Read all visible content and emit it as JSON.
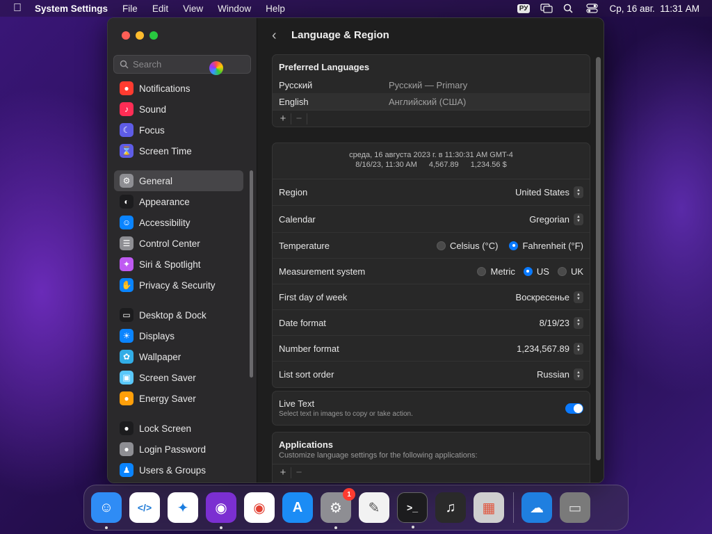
{
  "menubar": {
    "app_name": "System Settings",
    "menus": [
      "File",
      "Edit",
      "View",
      "Window",
      "Help"
    ],
    "input_source": "РУ",
    "clock": "Ср, 16 авг.  11:31 AM"
  },
  "sidebar": {
    "search_placeholder": "Search",
    "groups": [
      [
        {
          "label": "Notifications",
          "icon": "bell-icon",
          "color": "#ff3b30"
        },
        {
          "label": "Sound",
          "icon": "speaker-icon",
          "color": "#ff2d55"
        },
        {
          "label": "Focus",
          "icon": "moon-icon",
          "color": "#5e5ce6"
        },
        {
          "label": "Screen Time",
          "icon": "hourglass-icon",
          "color": "#5e5ce6"
        }
      ],
      [
        {
          "label": "General",
          "icon": "gear-icon",
          "color": "#8e8e93",
          "active": true
        },
        {
          "label": "Appearance",
          "icon": "appearance-icon",
          "color": "#1c1c1e"
        },
        {
          "label": "Accessibility",
          "icon": "accessibility-icon",
          "color": "#0a84ff"
        },
        {
          "label": "Control Center",
          "icon": "toggles-icon",
          "color": "#8e8e93"
        },
        {
          "label": "Siri & Spotlight",
          "icon": "siri-icon",
          "color": "#bf5af2"
        },
        {
          "label": "Privacy & Security",
          "icon": "hand-icon",
          "color": "#0a84ff"
        }
      ],
      [
        {
          "label": "Desktop & Dock",
          "icon": "dock-icon",
          "color": "#1c1c1e"
        },
        {
          "label": "Displays",
          "icon": "sun-icon",
          "color": "#0a84ff"
        },
        {
          "label": "Wallpaper",
          "icon": "flower-icon",
          "color": "#32ade6"
        },
        {
          "label": "Screen Saver",
          "icon": "screensaver-icon",
          "color": "#5ac8fa"
        },
        {
          "label": "Energy Saver",
          "icon": "lightbulb-icon",
          "color": "#ff9f0a"
        }
      ],
      [
        {
          "label": "Lock Screen",
          "icon": "lock-icon",
          "color": "#1c1c1e"
        },
        {
          "label": "Login Password",
          "icon": "padlock-icon",
          "color": "#8e8e93"
        },
        {
          "label": "Users & Groups",
          "icon": "users-icon",
          "color": "#0a84ff"
        }
      ]
    ]
  },
  "main": {
    "title": "Language & Region",
    "preferred_languages": {
      "heading": "Preferred Languages",
      "rows": [
        {
          "name": "Русский",
          "desc": "Русский — Primary"
        },
        {
          "name": "English",
          "desc": "Английский (США)"
        }
      ],
      "add": "+",
      "remove": "−"
    },
    "preview": {
      "line1": "среда, 16 августа 2023 г. в 11:30:31 AM GMT-4",
      "date": "8/16/23, 11:30 AM",
      "number": "4,567.89",
      "currency": "1,234.56 $"
    },
    "settings": {
      "region": {
        "label": "Region",
        "value": "United States"
      },
      "calendar": {
        "label": "Calendar",
        "value": "Gregorian"
      },
      "temperature": {
        "label": "Temperature",
        "options": [
          "Celsius (°C)",
          "Fahrenheit (°F)"
        ],
        "selected": 1
      },
      "measurement": {
        "label": "Measurement system",
        "options": [
          "Metric",
          "US",
          "UK"
        ],
        "selected": 1
      },
      "first_day": {
        "label": "First day of week",
        "value": "Воскресенье"
      },
      "date_format": {
        "label": "Date format",
        "value": "8/19/23"
      },
      "number_format": {
        "label": "Number format",
        "value": "1,234,567.89"
      },
      "sort_order": {
        "label": "List sort order",
        "value": "Russian"
      }
    },
    "live_text": {
      "title": "Live Text",
      "subtitle": "Select text in images to copy or take action.",
      "enabled": true
    },
    "applications": {
      "heading": "Applications",
      "subtitle": "Customize language settings for the following applications:"
    }
  },
  "dock": {
    "apps": [
      {
        "name": "Finder",
        "icon": "finder-icon",
        "color": "#2f8cf5",
        "running": true
      },
      {
        "name": "Visual Studio Code",
        "icon": "vscode-icon",
        "color": "#ffffff",
        "running": false
      },
      {
        "name": "Safari",
        "icon": "safari-icon",
        "color": "#ffffff",
        "running": false
      },
      {
        "name": "Firefox",
        "icon": "firefox-icon",
        "color": "#7b2fd1",
        "running": true
      },
      {
        "name": "Chrome",
        "icon": "chrome-icon",
        "color": "#ffffff",
        "running": false
      },
      {
        "name": "App Store",
        "icon": "appstore-icon",
        "color": "#1b8cf5",
        "running": false
      },
      {
        "name": "System Settings",
        "icon": "settings-icon",
        "color": "#8e8e93",
        "running": true,
        "badge": "1"
      },
      {
        "name": "TextEdit",
        "icon": "textedit-icon",
        "color": "#f2f2f2",
        "running": false
      },
      {
        "name": "Terminal",
        "icon": "terminal-icon",
        "color": "#1c1c1e",
        "running": true
      },
      {
        "name": "GarageBand",
        "icon": "guitar-icon",
        "color": "#2a2a2a",
        "running": false
      },
      {
        "name": "Launchpad",
        "icon": "launchpad-icon",
        "color": "#cfcfcf",
        "running": false
      }
    ],
    "extras": [
      {
        "name": "Weather",
        "icon": "weather-icon",
        "color": "#1f7fe0",
        "running": false
      },
      {
        "name": "Trash",
        "icon": "trash-icon",
        "color": "#7a7a7a",
        "running": false
      }
    ]
  }
}
